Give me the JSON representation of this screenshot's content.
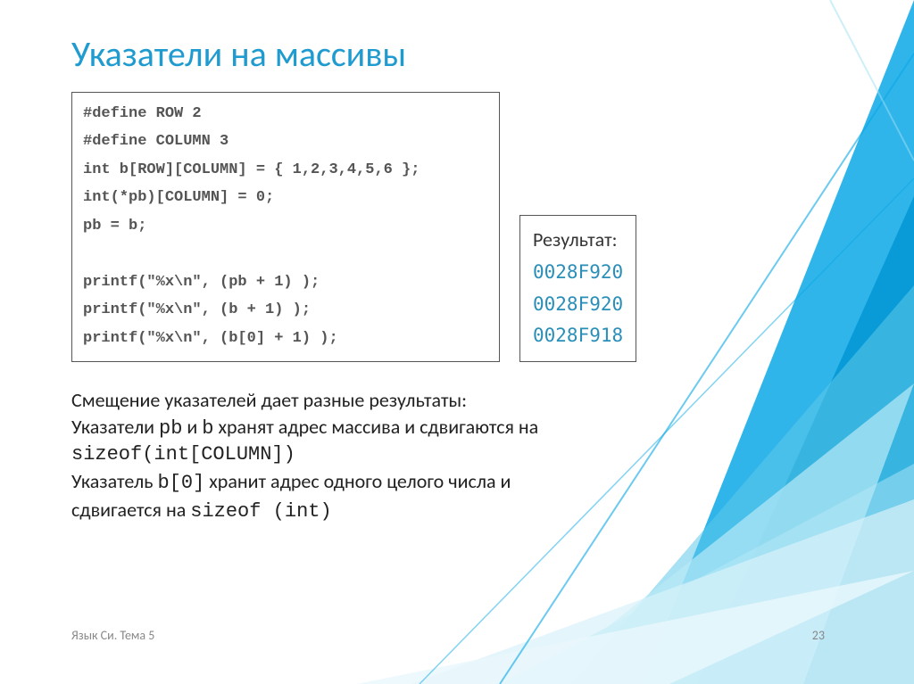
{
  "title": "Указатели на массивы",
  "code": {
    "l1": "#define ROW 2",
    "l2": "#define COLUMN 3",
    "l3": "int b[ROW][COLUMN] = { 1,2,3,4,5,6 };",
    "l4": "int(*pb)[COLUMN] = 0;",
    "l5": "pb = b;",
    "l6": "",
    "l7": "printf(\"%x\\n\", (pb + 1) );",
    "l8": "printf(\"%x\\n\", (b + 1) );",
    "l9": "printf(\"%x\\n\", (b[0] + 1) );"
  },
  "result": {
    "label": "Результат:",
    "v1": "0028F920",
    "v2": "0028F920",
    "v3": "0028F918"
  },
  "explain": {
    "p1": "Смещение указателей дает разные результаты:",
    "p2a": "Указатели ",
    "p2b": "pb",
    "p2c": " и ",
    "p2d": "b",
    "p2e": "  хранят адрес массива и сдвигаются на",
    "p3": "sizeof(int[COLUMN])",
    "p4a": "Указатель ",
    "p4b": "b[0]",
    "p4c": " хранит адрес одного целого числа и",
    "p5a": "сдвигается на ",
    "p5b": "sizeof (int)"
  },
  "footer": {
    "left": "Язык Си. Тема 5",
    "page": "23"
  }
}
